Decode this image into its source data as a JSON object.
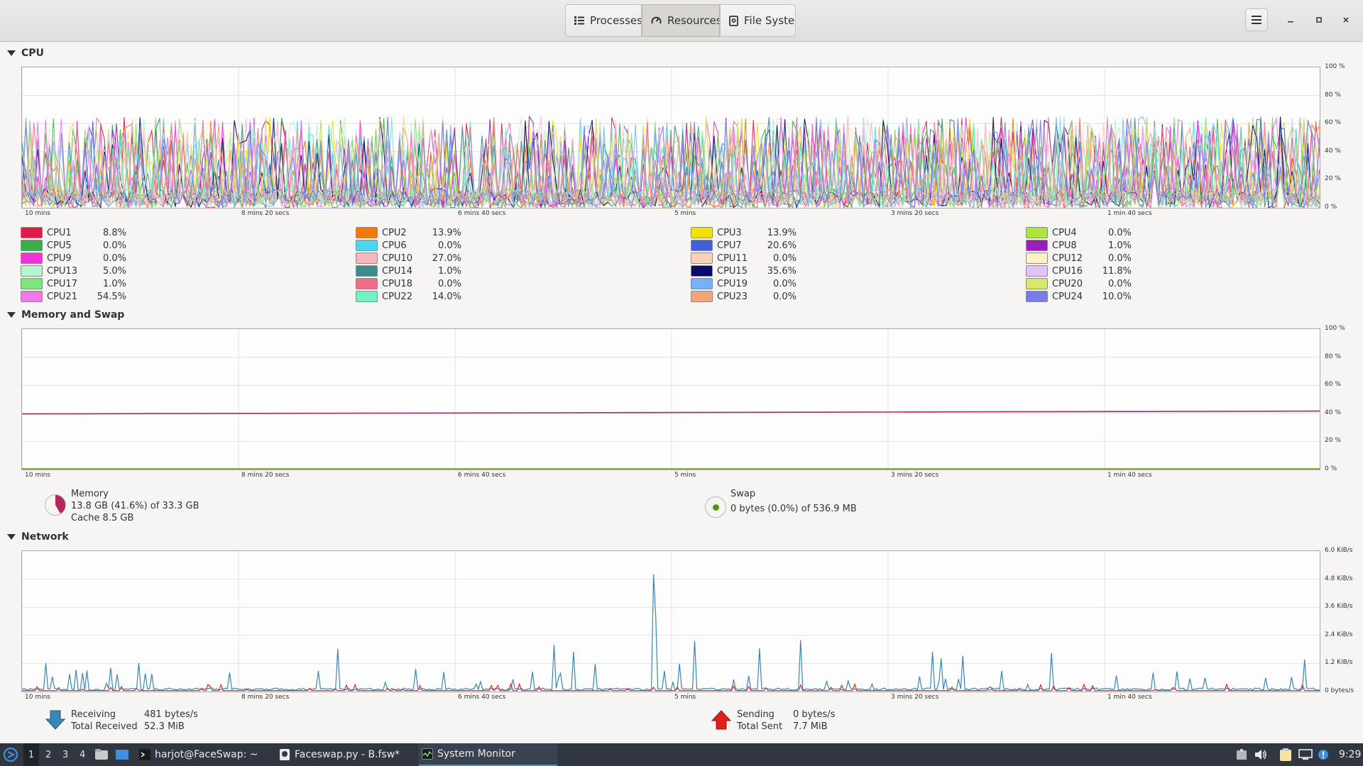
{
  "header": {
    "tabs": [
      {
        "label": "Processes",
        "icon": "list-icon"
      },
      {
        "label": "Resources",
        "icon": "gauge-icon"
      },
      {
        "label": "File Systems",
        "icon": "disk-icon"
      }
    ],
    "active_tab": "Resources"
  },
  "time_labels": [
    "10 mins",
    "8 mins 20 secs",
    "6 mins 40 secs",
    "5 mins",
    "3 mins 20 secs",
    "1 min 40 secs"
  ],
  "cpu": {
    "title": "CPU",
    "y_ticks": [
      "100 %",
      "80 %",
      "60 %",
      "40 %",
      "20 %",
      "0 %"
    ],
    "cores": [
      {
        "name": "CPU1",
        "value": "8.8%",
        "color": "#e01b4c"
      },
      {
        "name": "CPU2",
        "value": "13.9%",
        "color": "#f57900"
      },
      {
        "name": "CPU3",
        "value": "13.9%",
        "color": "#f5e10a"
      },
      {
        "name": "CPU4",
        "value": "0.0%",
        "color": "#aee33d"
      },
      {
        "name": "CPU5",
        "value": "0.0%",
        "color": "#3aae4f"
      },
      {
        "name": "CPU6",
        "value": "0.0%",
        "color": "#4ad6f1"
      },
      {
        "name": "CPU7",
        "value": "20.6%",
        "color": "#4160d6"
      },
      {
        "name": "CPU8",
        "value": "1.0%",
        "color": "#9a1eb8"
      },
      {
        "name": "CPU9",
        "value": "0.0%",
        "color": "#ef33d6"
      },
      {
        "name": "CPU10",
        "value": "27.0%",
        "color": "#f3b7bd"
      },
      {
        "name": "CPU11",
        "value": "0.0%",
        "color": "#f9d3b8"
      },
      {
        "name": "CPU12",
        "value": "0.0%",
        "color": "#fbf3c8"
      },
      {
        "name": "CPU13",
        "value": "5.0%",
        "color": "#b7f5cd"
      },
      {
        "name": "CPU14",
        "value": "1.0%",
        "color": "#3f8a8c"
      },
      {
        "name": "CPU15",
        "value": "35.6%",
        "color": "#0b0b66"
      },
      {
        "name": "CPU16",
        "value": "11.8%",
        "color": "#e2c3f5"
      },
      {
        "name": "CPU17",
        "value": "1.0%",
        "color": "#7be57a"
      },
      {
        "name": "CPU18",
        "value": "0.0%",
        "color": "#ef6d84"
      },
      {
        "name": "CPU19",
        "value": "0.0%",
        "color": "#74b1f5"
      },
      {
        "name": "CPU20",
        "value": "0.0%",
        "color": "#d6e96b"
      },
      {
        "name": "CPU21",
        "value": "54.5%",
        "color": "#ef7ae7"
      },
      {
        "name": "CPU22",
        "value": "14.0%",
        "color": "#72f0c6"
      },
      {
        "name": "CPU23",
        "value": "0.0%",
        "color": "#f2a57c"
      },
      {
        "name": "CPU24",
        "value": "10.0%",
        "color": "#7b7be8"
      }
    ]
  },
  "memory": {
    "title": "Memory and Swap",
    "y_ticks": [
      "100 %",
      "80 %",
      "60 %",
      "40 %",
      "20 %",
      "0 %"
    ],
    "memory_label": "Memory",
    "memory_usage": "13.8 GB (41.6%) of 33.3 GB",
    "cache": "Cache 8.5 GB",
    "memory_fraction": 0.416,
    "memory_color": "#b3275c",
    "swap_label": "Swap",
    "swap_usage": "0 bytes (0.0%) of 536.9 MB",
    "swap_fraction": 0.0,
    "swap_color": "#4e9a06"
  },
  "network": {
    "title": "Network",
    "y_ticks": [
      "6.0 KiB/s",
      "4.8 KiB/s",
      "3.6 KiB/s",
      "2.4 KiB/s",
      "1.2 KiB/s",
      "0 bytes/s"
    ],
    "receiving_label": "Receiving",
    "receiving_value": "481 bytes/s",
    "total_received_label": "Total Received",
    "total_received_value": "52.3 MiB",
    "sending_label": "Sending",
    "sending_value": "0 bytes/s",
    "total_sent_label": "Total Sent",
    "total_sent_value": "7.7 MiB",
    "receive_color": "#3a86b8",
    "send_color": "#e01b1b"
  },
  "taskbar": {
    "workspaces": [
      "1",
      "2",
      "3",
      "4"
    ],
    "windows": [
      {
        "label": "harjot@FaceSwap: ~",
        "icon": "terminal-icon"
      },
      {
        "label": "Faceswap.py - B.fsw*",
        "icon": "app-icon"
      },
      {
        "label": "System Monitor",
        "icon": "monitor-icon"
      }
    ],
    "clock": "9:29"
  }
}
